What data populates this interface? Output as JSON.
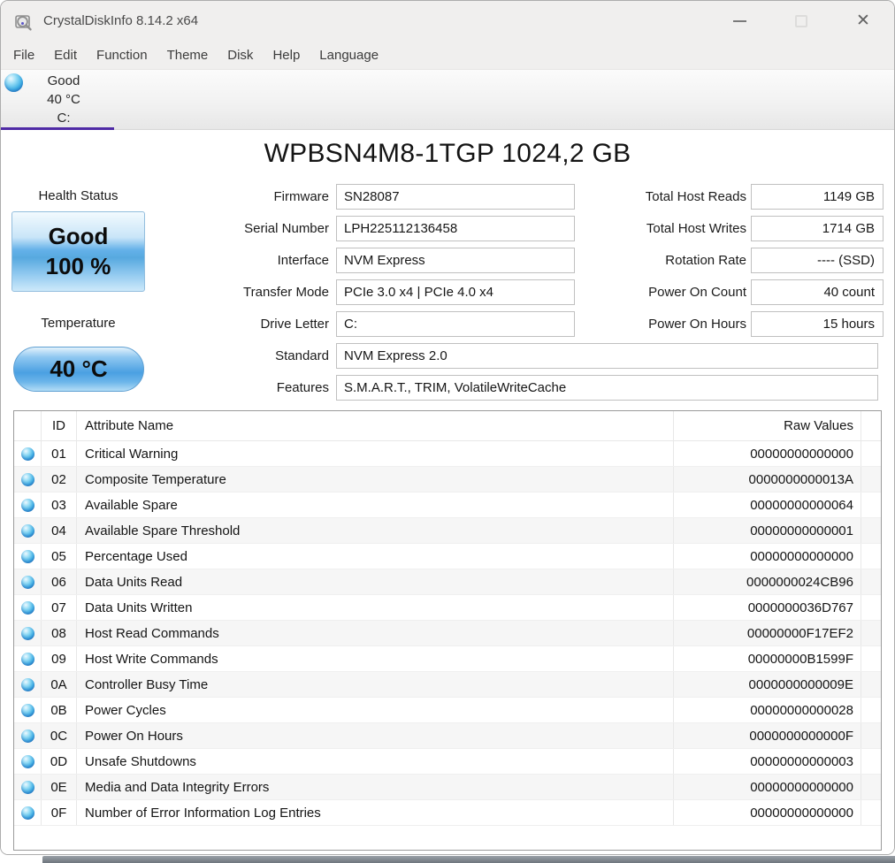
{
  "window": {
    "title": "CrystalDiskInfo 8.14.2 x64"
  },
  "menu": {
    "items": [
      "File",
      "Edit",
      "Function",
      "Theme",
      "Disk",
      "Help",
      "Language"
    ]
  },
  "drive_tab": {
    "status": "Good",
    "temperature": "40 °C",
    "letter": "C:"
  },
  "drive": {
    "title": "WPBSN4M8-1TGP 1024,2 GB",
    "health": {
      "label": "Health Status",
      "status": "Good",
      "percent": "100 %"
    },
    "temperature": {
      "label": "Temperature",
      "value": "40 °C"
    },
    "fields_left": [
      {
        "label": "Firmware",
        "value": "SN28087"
      },
      {
        "label": "Serial Number",
        "value": "LPH225112136458"
      },
      {
        "label": "Interface",
        "value": "NVM Express"
      },
      {
        "label": "Transfer Mode",
        "value": "PCIe 3.0 x4 | PCIe 4.0 x4"
      },
      {
        "label": "Drive Letter",
        "value": "C:"
      }
    ],
    "fields_wide": [
      {
        "label": "Standard",
        "value": "NVM Express 2.0"
      },
      {
        "label": "Features",
        "value": "S.M.A.R.T., TRIM, VolatileWriteCache"
      }
    ],
    "fields_right": [
      {
        "label": "Total Host Reads",
        "value": "1149 GB"
      },
      {
        "label": "Total Host Writes",
        "value": "1714 GB"
      },
      {
        "label": "Rotation Rate",
        "value": "---- (SSD)"
      },
      {
        "label": "Power On Count",
        "value": "40 count"
      },
      {
        "label": "Power On Hours",
        "value": "15 hours"
      }
    ]
  },
  "smart_table": {
    "headers": {
      "id": "ID",
      "name": "Attribute Name",
      "raw": "Raw Values"
    },
    "rows": [
      {
        "id": "01",
        "name": "Critical Warning",
        "raw": "00000000000000"
      },
      {
        "id": "02",
        "name": "Composite Temperature",
        "raw": "0000000000013A"
      },
      {
        "id": "03",
        "name": "Available Spare",
        "raw": "00000000000064"
      },
      {
        "id": "04",
        "name": "Available Spare Threshold",
        "raw": "00000000000001"
      },
      {
        "id": "05",
        "name": "Percentage Used",
        "raw": "00000000000000"
      },
      {
        "id": "06",
        "name": "Data Units Read",
        "raw": "0000000024CB96"
      },
      {
        "id": "07",
        "name": "Data Units Written",
        "raw": "0000000036D767"
      },
      {
        "id": "08",
        "name": "Host Read Commands",
        "raw": "00000000F17EF2"
      },
      {
        "id": "09",
        "name": "Host Write Commands",
        "raw": "00000000B1599F"
      },
      {
        "id": "0A",
        "name": "Controller Busy Time",
        "raw": "0000000000009E"
      },
      {
        "id": "0B",
        "name": "Power Cycles",
        "raw": "00000000000028"
      },
      {
        "id": "0C",
        "name": "Power On Hours",
        "raw": "0000000000000F"
      },
      {
        "id": "0D",
        "name": "Unsafe Shutdowns",
        "raw": "00000000000003"
      },
      {
        "id": "0E",
        "name": "Media and Data Integrity Errors",
        "raw": "00000000000000"
      },
      {
        "id": "0F",
        "name": "Number of Error Information Log Entries",
        "raw": "00000000000000"
      }
    ]
  },
  "colors": {
    "accent_purple": "#4f2aa5",
    "status_good_blue": "#2f9fe0",
    "health_button_blue": "#57a9df"
  }
}
